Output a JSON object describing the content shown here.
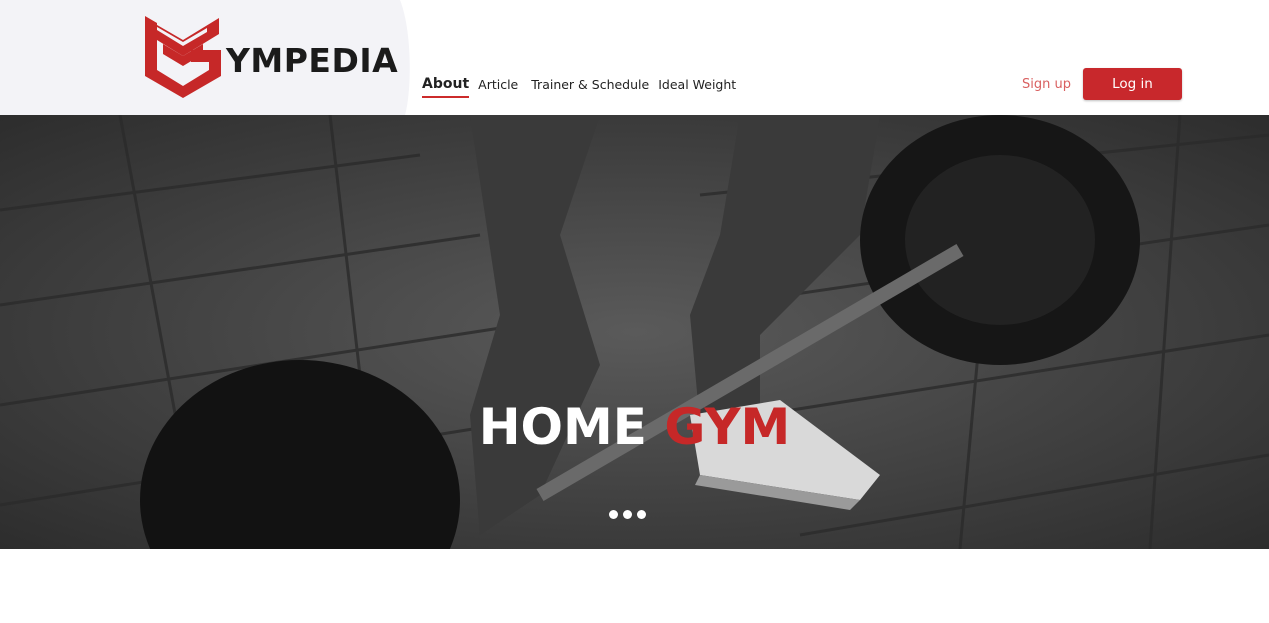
{
  "brand": {
    "name": "YMPEDIA",
    "accent": "#c8282c"
  },
  "nav": {
    "items": [
      {
        "label": "About",
        "active": true
      },
      {
        "label": "Article",
        "active": false
      },
      {
        "label": "Trainer & Schedule",
        "active": false
      },
      {
        "label": "Ideal Weight",
        "active": false
      }
    ]
  },
  "auth": {
    "signup_label": "Sign up",
    "login_label": "Log in"
  },
  "hero": {
    "title_word1": "HOME",
    "title_word2": "GYM",
    "image": "black-and-white photo of a person lifting a barbell on gym floor tiles",
    "slide_count": 3
  }
}
